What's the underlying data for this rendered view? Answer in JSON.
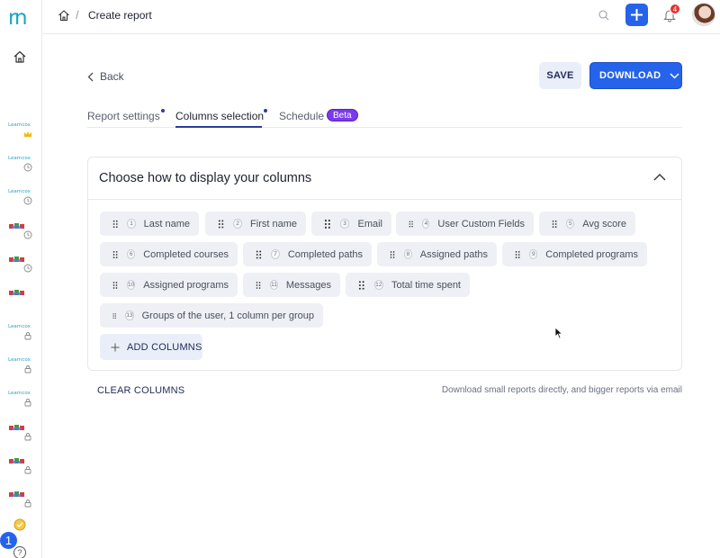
{
  "sidebar": {
    "logo": "rn",
    "items": [
      {
        "label": "Learncox",
        "kind": "text",
        "badge": "crown"
      },
      {
        "label": "Learncox",
        "kind": "text",
        "badge": "clock"
      },
      {
        "label": "Learncox",
        "kind": "text",
        "badge": "clock"
      },
      {
        "label": "",
        "kind": "flag",
        "badge": "clock"
      },
      {
        "label": "",
        "kind": "flag",
        "badge": "clock"
      },
      {
        "label": "",
        "kind": "flag",
        "badge": "none"
      },
      {
        "label": "Learncox",
        "kind": "text",
        "badge": "lock"
      },
      {
        "label": "Learncox",
        "kind": "text",
        "badge": "lock"
      },
      {
        "label": "Learncox",
        "kind": "text",
        "badge": "lock"
      },
      {
        "label": "",
        "kind": "flag",
        "badge": "lock"
      },
      {
        "label": "",
        "kind": "flag",
        "badge": "lock"
      },
      {
        "label": "",
        "kind": "flag",
        "badge": "lock"
      }
    ],
    "help_count": "1",
    "help_symbol": "?"
  },
  "topbar": {
    "breadcrumb_sep": "/",
    "title": "Create report",
    "notification_count": "4"
  },
  "actions": {
    "back_label": "Back",
    "save_label": "SAVE",
    "download_label": "DOWNLOAD"
  },
  "tabs": [
    {
      "label": "Report settings",
      "active": false,
      "dot": true
    },
    {
      "label": "Columns selection",
      "active": true,
      "dot": true
    },
    {
      "label": "Schedule",
      "active": false,
      "dot": false,
      "badge": "Beta"
    }
  ],
  "card": {
    "title": "Choose how to display your columns",
    "columns": [
      {
        "num": "1",
        "label": "Last name"
      },
      {
        "num": "2",
        "label": "First name"
      },
      {
        "num": "3",
        "label": "Email"
      },
      {
        "num": "4",
        "label": "User Custom Fields"
      },
      {
        "num": "5",
        "label": "Avg score"
      },
      {
        "num": "6",
        "label": "Completed courses"
      },
      {
        "num": "7",
        "label": "Completed paths"
      },
      {
        "num": "8",
        "label": "Assigned paths"
      },
      {
        "num": "9",
        "label": "Completed programs"
      },
      {
        "num": "10",
        "label": "Assigned programs"
      },
      {
        "num": "11",
        "label": "Messages"
      },
      {
        "num": "12",
        "label": "Total time spent"
      },
      {
        "num": "13",
        "label": "Groups of the user, 1 column per group"
      }
    ],
    "add_columns_label": "ADD COLUMNS"
  },
  "footer": {
    "clear_label": "CLEAR COLUMNS",
    "hint": "Download small reports directly, and bigger reports via email"
  },
  "colors": {
    "accent": "#2563eb",
    "tab_underline": "#2d3b9e",
    "beta": "#7c3aed",
    "chip_bg": "#eef0f5",
    "notification": "#e5322d",
    "logo": "#18a4c8"
  }
}
